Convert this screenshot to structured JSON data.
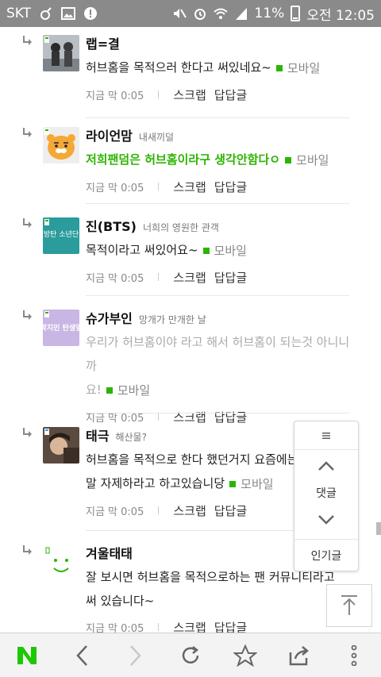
{
  "status_bar": {
    "carrier": "SKT",
    "battery": "11%",
    "time": "오전 12:05"
  },
  "comments": [
    {
      "nick": "랩=결",
      "title": "",
      "text": "허브홈을 목적으러 한다고 써있네요~",
      "style": "normal",
      "mobile": "모바일",
      "time": "지금 막 0:05",
      "scrap": "스크랩",
      "reply": "답답글"
    },
    {
      "nick": "라이언맘",
      "title": "내새끼덜",
      "text": "저희팬덤은 허브홈이라구 생각안함다ㅇ",
      "style": "green",
      "mobile": "모바일",
      "time": "지금 막 0:05",
      "scrap": "스크랩",
      "reply": "답답글"
    },
    {
      "nick": "진(BTS)",
      "title": "너희의 영원한 관객",
      "text": "목적이라고 써있어요~",
      "style": "normal",
      "mobile": "모바일",
      "time": "지금 막 0:05",
      "scrap": "스크랩",
      "reply": "답답글"
    },
    {
      "nick": "슈가부인",
      "title": "망개가 만개한 날",
      "text": "우리가 허브홈이야 라고 해서 허브홈이 되는것 아니니까",
      "text2": "요!",
      "style": "gray",
      "mobile": "모바일",
      "time": "지금 막 0:05",
      "scrap": "스크랩",
      "reply": "답답글"
    },
    {
      "nick": "태극",
      "title": "해산물?",
      "text": "허브홈을 목적으로 한다 했던거지 요즘에는",
      "text2": "말 자제하라고 하고있습니당",
      "style": "normal",
      "mobile": "모바일",
      "time": "지금 막 0:05",
      "scrap": "스크랩",
      "reply": "답답글"
    },
    {
      "nick": "겨울태태",
      "title": "",
      "text": "잘 보시면 허브홈을 목적으로하는 팬 커뮤니티라고",
      "text2": "써 있습니다~",
      "style": "normal",
      "mobile": "",
      "time": "지금 막 0:05",
      "scrap": "스크랩",
      "reply": "답답글"
    }
  ],
  "avatars": {
    "c3": "방탄 소년단",
    "c4": "박지민 탄생일"
  },
  "float_panel": {
    "comments_label": "댓글",
    "popular_label": "인기글"
  },
  "colors": {
    "accent_green": "#2db400",
    "status_bar": "#8a8a8a"
  }
}
